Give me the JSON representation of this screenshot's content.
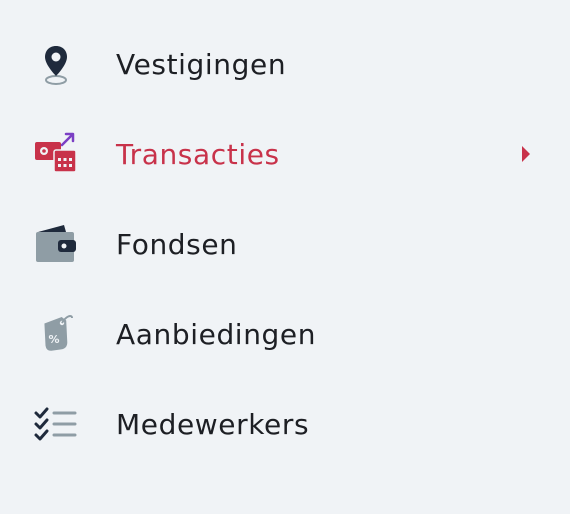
{
  "menu": {
    "items": [
      {
        "label": "Vestigingen",
        "icon": "location-pin-icon",
        "active": false
      },
      {
        "label": "Transacties",
        "icon": "transaction-exchange-icon",
        "active": true
      },
      {
        "label": "Fondsen",
        "icon": "wallet-icon",
        "active": false
      },
      {
        "label": "Aanbiedingen",
        "icon": "discount-tag-icon",
        "active": false
      },
      {
        "label": "Medewerkers",
        "icon": "checklist-icon",
        "active": false
      }
    ],
    "active_chevron_icon": "chevron-right-icon"
  },
  "colors": {
    "background": "#f0f3f6",
    "text": "#1d1f24",
    "active": "#c8324a",
    "icon_dark": "#1f2a3c",
    "icon_grey": "#8f9da5",
    "accent_purple": "#7b3fc4"
  }
}
